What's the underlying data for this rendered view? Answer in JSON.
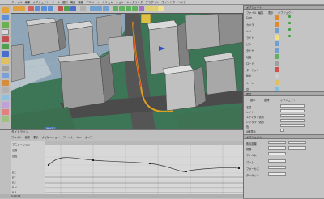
{
  "menubar": {
    "items": [
      "ファイル",
      "編集",
      "オブジェクト",
      "ツール",
      "選択",
      "構造",
      "機能",
      "アニメート",
      "シミュレーション",
      "レンダリング",
      "プラグイン",
      "ウインドウ",
      "ヘルプ"
    ]
  },
  "right_panel": {
    "title": "オブジェクト",
    "tabs": [
      "ファイル",
      "編集",
      "表示",
      "オブジェクト"
    ],
    "object_rows": [
      "Cam",
      "カメラ",
      "ヘリ",
      "ライト",
      "ビル",
      "タイヤ",
      "地面",
      "ロード",
      "ターゲット",
      "Null",
      "シーン",
      "空"
    ],
    "attributes_title": "属性",
    "attributes_tabs": [
      "基本",
      "座標",
      "オブジェクト"
    ],
    "attr_rows": [
      "名前",
      "レイヤ",
      "エディタで表示",
      "レンダラで表示",
      "色",
      "X線表示"
    ],
    "section2_title": "オブジェクト",
    "section2_rows": [
      "焦点距離",
      "視野",
      "フィルム",
      "ズーム",
      "フォーカス",
      "ターゲット"
    ]
  },
  "timeline": {
    "title": "タイムライン",
    "menu": [
      "ファイル",
      "編集",
      "表示",
      "ナビゲーション",
      "フレーム",
      "キー",
      "カーブ"
    ],
    "tracks": [
      "アニメーション",
      "位置",
      "回転",
      "P.X",
      "P.Y",
      "P.Z",
      "R.H",
      "R.P"
    ]
  },
  "viewport": {
    "label": "カメラ"
  },
  "status": {
    "text": "0:00:01"
  }
}
